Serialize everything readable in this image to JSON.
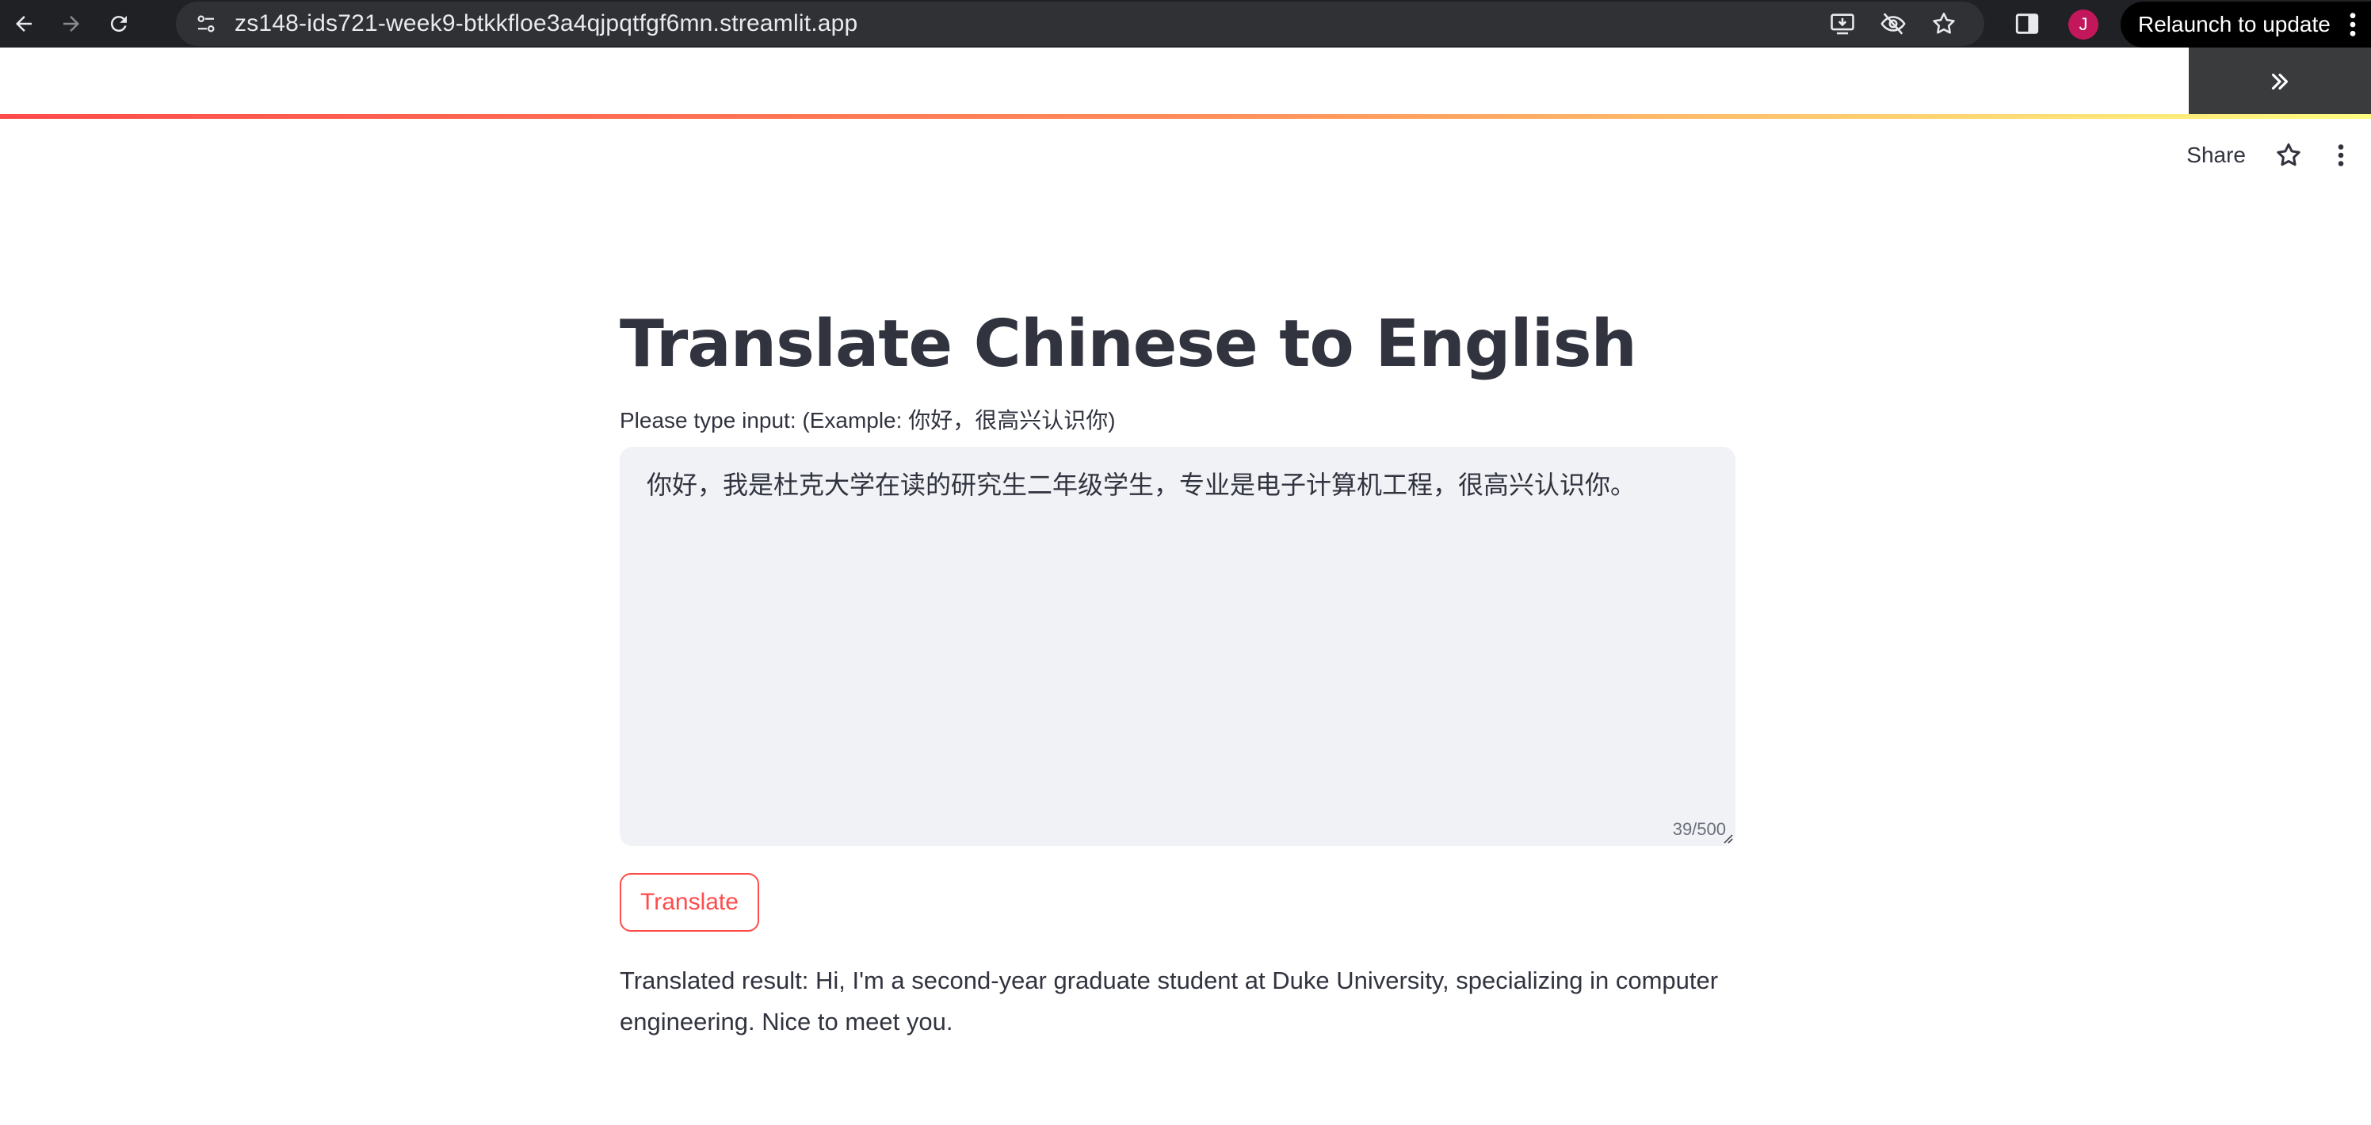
{
  "browser": {
    "url": "zs148-ids721-week9-btkkfloe3a4qjpqtfgf6mn.streamlit.app",
    "relaunch_label": "Relaunch to update",
    "profile_initial": "J",
    "icons": [
      "back-icon",
      "forward-icon",
      "reload-icon",
      "site-info-icon",
      "install-app-icon",
      "eye-off-icon",
      "bookmark-star-icon",
      "side-panel-icon",
      "more-vert-icon"
    ]
  },
  "streamlit": {
    "share_label": "Share",
    "icons": [
      "sidebar-expand-icon",
      "star-icon",
      "main-menu-icon"
    ]
  },
  "main": {
    "title": "Translate Chinese to English",
    "input_label": "Please type input: (Example: 你好，很高兴认识你)",
    "input_value": "你好，我是杜克大学在读的研究生二年级学生，专业是电子计算机工程，很高兴认识你。",
    "char_count": "39/500",
    "button_label": "Translate",
    "result": "Translated result: Hi, I'm a second-year graduate student at Duke University, specializing in computer engineering. Nice to meet you."
  },
  "colors": {
    "chrome_bg": "#202124",
    "omnibox_bg": "#303134",
    "accent": "#ff4b4b",
    "text": "#31333f",
    "textarea_bg": "#f0f2f6"
  }
}
